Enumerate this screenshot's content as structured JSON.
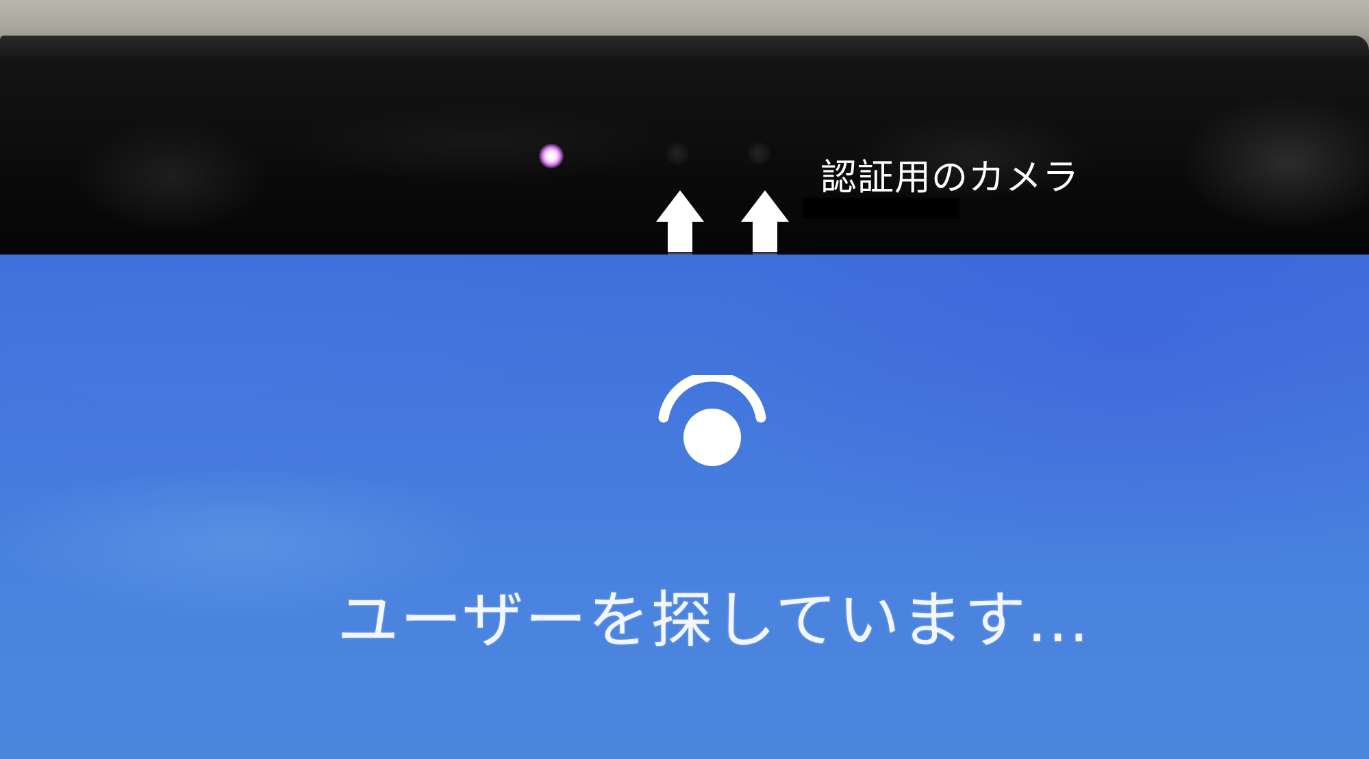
{
  "caption": {
    "text": "認証用のカメラ"
  },
  "screen": {
    "status_text": "ユーザーを探しています..."
  },
  "icons": {
    "face_recognition": "face-recognition-icon",
    "arrow": "arrow-up-icon",
    "ir_light": "infrared-light",
    "camera_lens": "camera-lens"
  },
  "colors": {
    "bezel": "#0b0b0b",
    "screen_blue": "#4579dd",
    "ir_light": "#e38cf0",
    "text": "#ffffff"
  }
}
